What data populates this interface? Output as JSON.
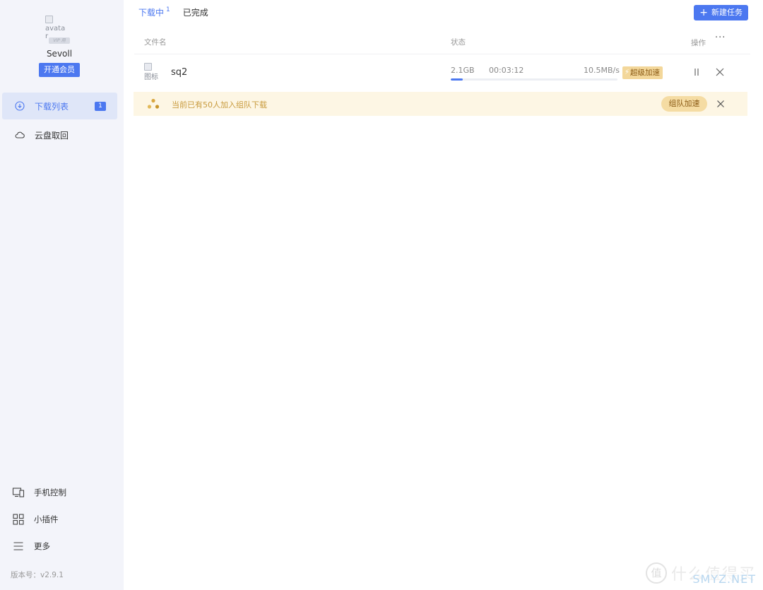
{
  "sidebar": {
    "avatar_alt": "avatar",
    "vip_tag": "VIP 用",
    "username": "Sevoll",
    "vip_button": "开通会员",
    "nav": [
      {
        "label": "下载列表",
        "badge": "1",
        "icon": "download-circle-icon",
        "active": true
      },
      {
        "label": "云盘取回",
        "icon": "cloud-icon",
        "active": false
      }
    ],
    "bottom": [
      {
        "label": "手机控制",
        "icon": "devices-icon"
      },
      {
        "label": "小插件",
        "icon": "grid-icon"
      },
      {
        "label": "更多",
        "icon": "menu-icon"
      }
    ],
    "version": "版本号：v2.9.1"
  },
  "main": {
    "tabs": [
      {
        "label": "下载中",
        "count": "1",
        "active": true
      },
      {
        "label": "已完成",
        "active": false
      }
    ],
    "new_task_button": "新建任务",
    "header": {
      "name": "文件名",
      "status": "状态",
      "operation": "操作",
      "more": "···"
    },
    "task": {
      "icon_alt": "图标",
      "name": "sq2",
      "size": "2.1GB",
      "elapsed": "00:03:12",
      "speed": "10.5MB/s",
      "progress": 0.07,
      "super_button": "超级加速"
    },
    "banner": {
      "text": "当前已有50人加入组队下载",
      "team_button": "组队加速"
    }
  },
  "watermark": {
    "logo": "值",
    "text": "什么值得买",
    "sub": "SMYZ.NET"
  },
  "colors": {
    "accent": "#4c78f0",
    "gold": "#f3d79a",
    "banner_bg": "#fdf6e4"
  }
}
